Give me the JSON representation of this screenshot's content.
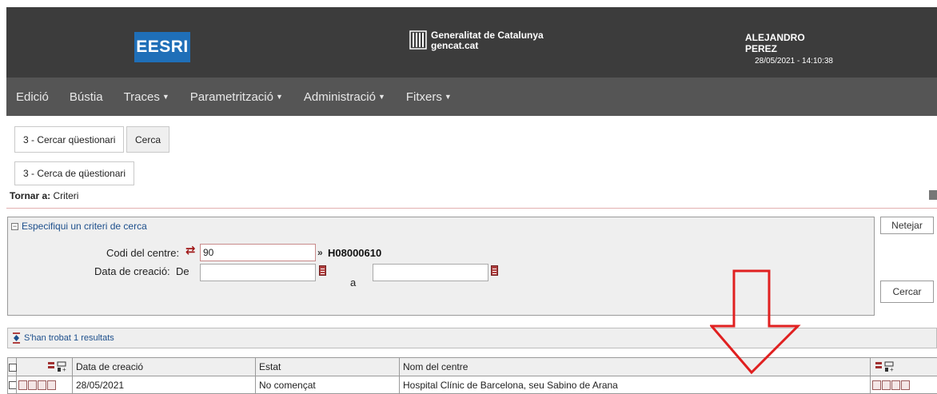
{
  "header": {
    "app_logo": "EESRI",
    "org_name": "Generalitat de Catalunya",
    "org_site": "gencat.cat",
    "user_name": "ALEJANDRO PEREZ",
    "datetime": "28/05/2021 - 14:10:38"
  },
  "nav": [
    {
      "label": "Edició",
      "dropdown": false
    },
    {
      "label": "Bústia",
      "dropdown": false
    },
    {
      "label": "Traces",
      "dropdown": true
    },
    {
      "label": "Parametrització",
      "dropdown": true
    },
    {
      "label": "Administració",
      "dropdown": true
    },
    {
      "label": "Fitxers",
      "dropdown": true
    }
  ],
  "tabs": {
    "tab1": "3 - Cercar qüestionari",
    "tab2": "Cerca",
    "tab3": "3 - Cerca de qüestionari"
  },
  "back": {
    "prefix": "Tornar a:",
    "link": "Criteri"
  },
  "criteria": {
    "title": "Especifiqui un criteri de cerca",
    "centre_label": "Codi del centre:",
    "centre_value": "90",
    "centre_code": "H08000610",
    "date_label": "Data de creació:",
    "from_label": "De",
    "to_label": "a",
    "date_from": "",
    "date_to": ""
  },
  "buttons": {
    "clear": "Netejar",
    "search": "Cercar"
  },
  "results": {
    "summary": "S'han trobat 1 resultats",
    "columns": [
      "Data de creació",
      "Estat",
      "Nom del centre"
    ],
    "rows": [
      {
        "date": "28/05/2021",
        "status": "No començat",
        "centre": "Hospital Clínic de Barcelona, seu Sabino de Arana"
      }
    ]
  },
  "colors": {
    "header_bg": "#3c3c3c",
    "nav_bg": "#555555",
    "logo_blue": "#1f6fb8",
    "annotation_red": "#e02020"
  }
}
